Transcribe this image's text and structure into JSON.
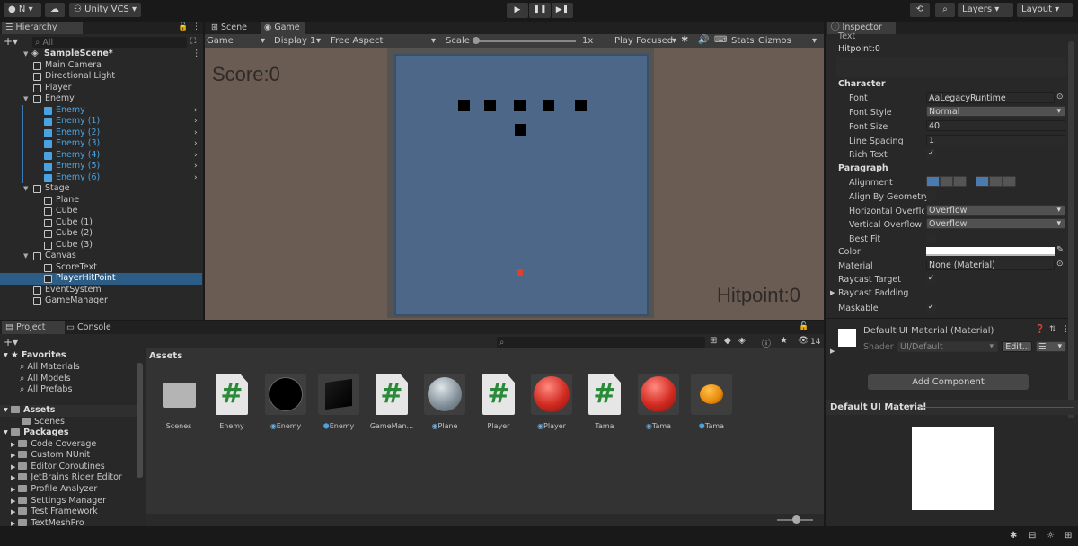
{
  "toolbar": {
    "account": "N",
    "cloud_label": "☁",
    "vcs": "Unity VCS",
    "layers": "Layers",
    "layout": "Layout"
  },
  "hierarchy": {
    "tab": "Hierarchy",
    "search_placeholder": "All",
    "scene": "SampleScene*",
    "items": [
      {
        "label": "Main Camera",
        "indent": 1,
        "kind": "obj"
      },
      {
        "label": "Directional Light",
        "indent": 1,
        "kind": "obj"
      },
      {
        "label": "Player",
        "indent": 1,
        "kind": "obj"
      },
      {
        "label": "Enemy",
        "indent": 1,
        "kind": "obj",
        "expanded": true
      },
      {
        "label": "Enemy",
        "indent": 2,
        "kind": "prefab"
      },
      {
        "label": "Enemy (1)",
        "indent": 2,
        "kind": "prefab"
      },
      {
        "label": "Enemy (2)",
        "indent": 2,
        "kind": "prefab"
      },
      {
        "label": "Enemy (3)",
        "indent": 2,
        "kind": "prefab"
      },
      {
        "label": "Enemy (4)",
        "indent": 2,
        "kind": "prefab"
      },
      {
        "label": "Enemy (5)",
        "indent": 2,
        "kind": "prefab"
      },
      {
        "label": "Enemy (6)",
        "indent": 2,
        "kind": "prefab"
      },
      {
        "label": "Stage",
        "indent": 1,
        "kind": "obj",
        "expanded": true
      },
      {
        "label": "Plane",
        "indent": 2,
        "kind": "obj"
      },
      {
        "label": "Cube",
        "indent": 2,
        "kind": "obj"
      },
      {
        "label": "Cube (1)",
        "indent": 2,
        "kind": "obj"
      },
      {
        "label": "Cube (2)",
        "indent": 2,
        "kind": "obj"
      },
      {
        "label": "Cube (3)",
        "indent": 2,
        "kind": "obj"
      },
      {
        "label": "Canvas",
        "indent": 1,
        "kind": "obj",
        "expanded": true
      },
      {
        "label": "ScoreText",
        "indent": 2,
        "kind": "obj"
      },
      {
        "label": "PlayerHitPoint",
        "indent": 2,
        "kind": "obj",
        "selected": true
      },
      {
        "label": "EventSystem",
        "indent": 1,
        "kind": "obj"
      },
      {
        "label": "GameManager",
        "indent": 1,
        "kind": "obj"
      }
    ]
  },
  "game": {
    "tab_scene": "Scene",
    "tab_game": "Game",
    "mode": "Game",
    "display": "Display 1",
    "aspect": "Free Aspect",
    "scale_label": "Scale",
    "scale_value": "1x",
    "play_focused": "Play Focused",
    "stats": "Stats",
    "gizmos": "Gizmos",
    "score_text": "Score:0",
    "hitpoint_text": "Hitpoint:0"
  },
  "inspector": {
    "tab": "Inspector",
    "text_header": "Text",
    "text_value": "Hitpoint:0",
    "character": "Character",
    "font_label": "Font",
    "font_value": "LegacyRuntime",
    "font_style_label": "Font Style",
    "font_style_value": "Normal",
    "font_size_label": "Font Size",
    "font_size_value": "40",
    "line_spacing_label": "Line Spacing",
    "line_spacing_value": "1",
    "rich_text_label": "Rich Text",
    "paragraph": "Paragraph",
    "alignment_label": "Alignment",
    "align_geometry_label": "Align By Geometry",
    "h_overflow_label": "Horizontal Overflow",
    "h_overflow_value": "Overflow",
    "v_overflow_label": "Vertical Overflow",
    "v_overflow_value": "Overflow",
    "best_fit_label": "Best Fit",
    "color_label": "Color",
    "material_label": "Material",
    "material_value": "None (Material)",
    "raycast_target_label": "Raycast Target",
    "raycast_padding_label": "Raycast Padding",
    "maskable_label": "Maskable",
    "material_title": "Default UI Material (Material)",
    "shader_label": "Shader",
    "shader_value": "UI/Default",
    "edit_label": "Edit...",
    "add_component": "Add Component",
    "preview_title": "Default UI Material"
  },
  "project": {
    "tab_project": "Project",
    "tab_console": "Console",
    "assets_header": "Assets",
    "hidden_count": "14",
    "favorites": "Favorites",
    "fav_items": [
      "All Materials",
      "All Models",
      "All Prefabs"
    ],
    "assets_root": "Assets",
    "assets_children": [
      "Scenes"
    ],
    "packages": "Packages",
    "package_items": [
      "Code Coverage",
      "Custom NUnit",
      "Editor Coroutines",
      "JetBrains Rider Editor",
      "Profile Analyzer",
      "Settings Manager",
      "Test Framework",
      "TextMeshPro"
    ],
    "assets": [
      {
        "name": "Scenes",
        "type": "folder"
      },
      {
        "name": "Enemy",
        "type": "script"
      },
      {
        "name": "Enemy",
        "type": "material-black"
      },
      {
        "name": "Enemy",
        "type": "prefab-cube"
      },
      {
        "name": "GameMan...",
        "type": "script"
      },
      {
        "name": "Plane",
        "type": "material-glass"
      },
      {
        "name": "Player",
        "type": "script"
      },
      {
        "name": "Player",
        "type": "material-red"
      },
      {
        "name": "Tama",
        "type": "script"
      },
      {
        "name": "Tama",
        "type": "material-red"
      },
      {
        "name": "Tama",
        "type": "prefab-orange"
      }
    ]
  },
  "colors": {
    "selection": "#2c5d87",
    "enemy_blue": "#4aa3e0",
    "game_bg": "#4d6788",
    "game_frame": "#6b5c53",
    "hit_red": "#e0402a"
  }
}
